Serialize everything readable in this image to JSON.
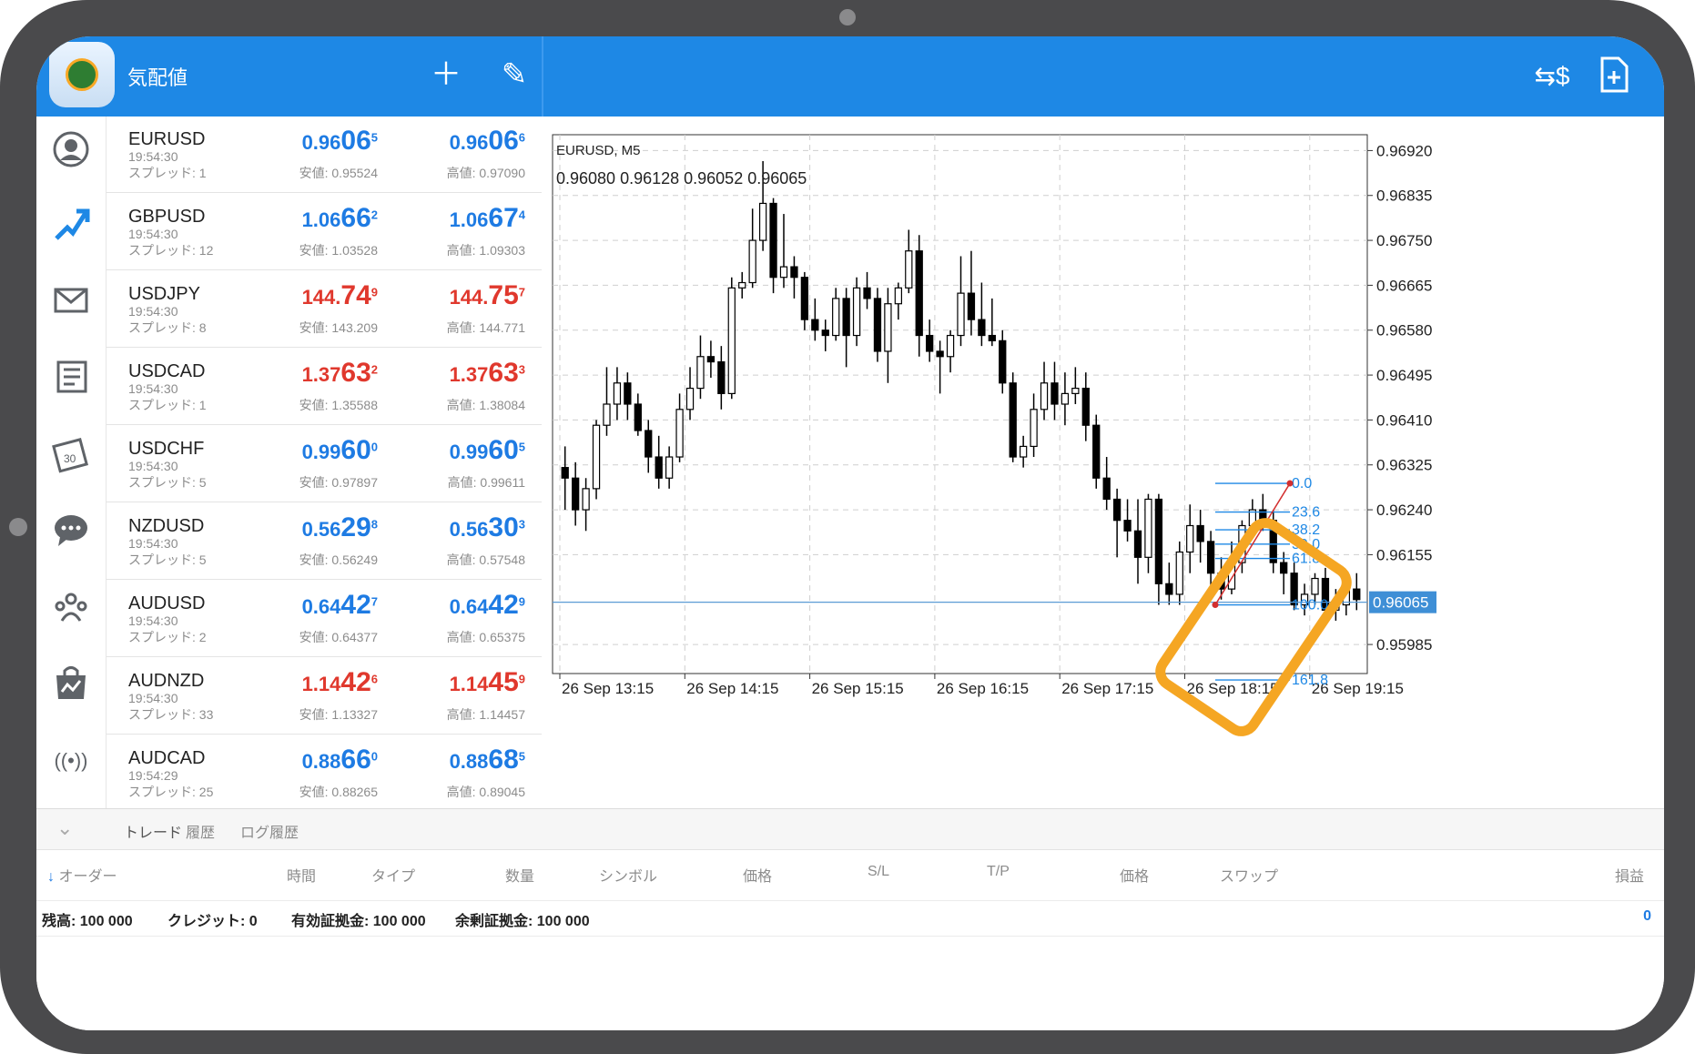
{
  "header": {
    "title": "気配値",
    "add_icon": "plus-icon",
    "edit_icon": "pencil-icon",
    "currency_icon": "currency-switch-icon",
    "new_order_icon": "new-document-icon"
  },
  "nav": [
    "quotes-icon",
    "chart-icon",
    "mail-icon",
    "news-icon",
    "calendar-icon",
    "chat-icon",
    "community-icon",
    "market-icon",
    "signal-icon"
  ],
  "quotes": [
    {
      "symbol": "EURUSD",
      "time": "19:54:30",
      "spread": "スプレッド: 1",
      "bid_head": "0.96",
      "bid_big": "06",
      "bid_sup": "5",
      "ask_head": "0.96",
      "ask_big": "06",
      "ask_sup": "6",
      "low": "安値: 0.95524",
      "high": "高値: 0.97090",
      "color": "blue"
    },
    {
      "symbol": "GBPUSD",
      "time": "19:54:30",
      "spread": "スプレッド: 12",
      "bid_head": "1.06",
      "bid_big": "66",
      "bid_sup": "2",
      "ask_head": "1.06",
      "ask_big": "67",
      "ask_sup": "4",
      "low": "安値: 1.03528",
      "high": "高値: 1.09303",
      "color": "blue"
    },
    {
      "symbol": "USDJPY",
      "time": "19:54:30",
      "spread": "スプレッド: 8",
      "bid_head": "144.",
      "bid_big": "74",
      "bid_sup": "9",
      "ask_head": "144.",
      "ask_big": "75",
      "ask_sup": "7",
      "low": "安値: 143.209",
      "high": "高値: 144.771",
      "color": "red"
    },
    {
      "symbol": "USDCAD",
      "time": "19:54:30",
      "spread": "スプレッド: 1",
      "bid_head": "1.37",
      "bid_big": "63",
      "bid_sup": "2",
      "ask_head": "1.37",
      "ask_big": "63",
      "ask_sup": "3",
      "low": "安値: 1.35588",
      "high": "高値: 1.38084",
      "color": "red"
    },
    {
      "symbol": "USDCHF",
      "time": "19:54:30",
      "spread": "スプレッド: 5",
      "bid_head": "0.99",
      "bid_big": "60",
      "bid_sup": "0",
      "ask_head": "0.99",
      "ask_big": "60",
      "ask_sup": "5",
      "low": "安値: 0.97897",
      "high": "高値: 0.99611",
      "color": "blue"
    },
    {
      "symbol": "NZDUSD",
      "time": "19:54:30",
      "spread": "スプレッド: 5",
      "bid_head": "0.56",
      "bid_big": "29",
      "bid_sup": "8",
      "ask_head": "0.56",
      "ask_big": "30",
      "ask_sup": "3",
      "low": "安値: 0.56249",
      "high": "高値: 0.57548",
      "color": "blue"
    },
    {
      "symbol": "AUDUSD",
      "time": "19:54:30",
      "spread": "スプレッド: 2",
      "bid_head": "0.64",
      "bid_big": "42",
      "bid_sup": "7",
      "ask_head": "0.64",
      "ask_big": "42",
      "ask_sup": "9",
      "low": "安値: 0.64377",
      "high": "高値: 0.65375",
      "color": "blue"
    },
    {
      "symbol": "AUDNZD",
      "time": "19:54:30",
      "spread": "スプレッド: 33",
      "bid_head": "1.14",
      "bid_big": "42",
      "bid_sup": "6",
      "ask_head": "1.14",
      "ask_big": "45",
      "ask_sup": "9",
      "low": "安値: 1.13327",
      "high": "高値: 1.14457",
      "color": "red"
    },
    {
      "symbol": "AUDCAD",
      "time": "19:54:29",
      "spread": "スプレッド: 25",
      "bid_head": "0.88",
      "bid_big": "66",
      "bid_sup": "0",
      "ask_head": "0.88",
      "ask_big": "68",
      "ask_sup": "5",
      "low": "安値: 0.88265",
      "high": "高値: 0.89045",
      "color": "blue"
    }
  ],
  "chart": {
    "symbol_tf": "EURUSD, M5",
    "ohlc": "0.96080 0.96128 0.96052 0.96065",
    "current_price": "0.96065",
    "price_labels": [
      "0.96920",
      "0.96835",
      "0.96750",
      "0.96665",
      "0.96580",
      "0.96495",
      "0.96410",
      "0.96325",
      "0.96240",
      "0.96155",
      "0.95985"
    ],
    "time_labels": [
      "26 Sep 13:15",
      "26 Sep 14:15",
      "26 Sep 15:15",
      "26 Sep 16:15",
      "26 Sep 17:15",
      "26 Sep 18:15",
      "26 Sep 19:15"
    ],
    "fib_levels": [
      "0.0",
      "23.6",
      "38.2",
      "50.0",
      "61.8",
      "100.0",
      "161.8"
    ],
    "highlight_color": "#f5a623"
  },
  "chart_data": {
    "type": "candlestick",
    "title": "EURUSD, M5",
    "ylim": [
      0.9593,
      0.9695
    ],
    "candles": [
      [
        0.9632,
        0.9636,
        0.9624,
        0.963
      ],
      [
        0.963,
        0.9633,
        0.9621,
        0.9624
      ],
      [
        0.9624,
        0.963,
        0.962,
        0.9628
      ],
      [
        0.9628,
        0.9641,
        0.9626,
        0.964
      ],
      [
        0.964,
        0.9651,
        0.9638,
        0.9644
      ],
      [
        0.9644,
        0.9651,
        0.9641,
        0.9648
      ],
      [
        0.9648,
        0.965,
        0.9641,
        0.9644
      ],
      [
        0.9644,
        0.9646,
        0.9638,
        0.9639
      ],
      [
        0.9639,
        0.9641,
        0.9631,
        0.9634
      ],
      [
        0.9634,
        0.9638,
        0.9628,
        0.963
      ],
      [
        0.963,
        0.9636,
        0.9628,
        0.9634
      ],
      [
        0.9634,
        0.9646,
        0.9633,
        0.9643
      ],
      [
        0.9643,
        0.9651,
        0.9641,
        0.9647
      ],
      [
        0.9647,
        0.9657,
        0.9645,
        0.9653
      ],
      [
        0.9653,
        0.9656,
        0.9649,
        0.9652
      ],
      [
        0.9652,
        0.9655,
        0.9643,
        0.9646
      ],
      [
        0.9646,
        0.9668,
        0.9645,
        0.9666
      ],
      [
        0.9666,
        0.9669,
        0.9664,
        0.9667
      ],
      [
        0.9667,
        0.9681,
        0.9666,
        0.9675
      ],
      [
        0.9675,
        0.969,
        0.9673,
        0.9682
      ],
      [
        0.9682,
        0.9683,
        0.9665,
        0.9668
      ],
      [
        0.9668,
        0.968,
        0.9666,
        0.967
      ],
      [
        0.967,
        0.9672,
        0.9664,
        0.9668
      ],
      [
        0.9668,
        0.9669,
        0.9658,
        0.966
      ],
      [
        0.966,
        0.9664,
        0.9656,
        0.9658
      ],
      [
        0.9658,
        0.966,
        0.9654,
        0.9657
      ],
      [
        0.9657,
        0.9666,
        0.9656,
        0.9664
      ],
      [
        0.9664,
        0.9666,
        0.9651,
        0.9657
      ],
      [
        0.9657,
        0.9668,
        0.9655,
        0.9666
      ],
      [
        0.9666,
        0.9669,
        0.9662,
        0.9664
      ],
      [
        0.9664,
        0.9666,
        0.9652,
        0.9654
      ],
      [
        0.9654,
        0.9666,
        0.9648,
        0.9663
      ],
      [
        0.9663,
        0.9667,
        0.966,
        0.9666
      ],
      [
        0.9666,
        0.9677,
        0.9665,
        0.9673
      ],
      [
        0.9673,
        0.9676,
        0.9653,
        0.9657
      ],
      [
        0.9657,
        0.966,
        0.9652,
        0.9654
      ],
      [
        0.9654,
        0.9656,
        0.9646,
        0.9653
      ],
      [
        0.9653,
        0.9658,
        0.965,
        0.9657
      ],
      [
        0.9657,
        0.9672,
        0.9655,
        0.9665
      ],
      [
        0.9665,
        0.9673,
        0.9657,
        0.966
      ],
      [
        0.966,
        0.9667,
        0.9655,
        0.9657
      ],
      [
        0.9657,
        0.9664,
        0.9655,
        0.9656
      ],
      [
        0.9656,
        0.9658,
        0.9646,
        0.9648
      ],
      [
        0.9648,
        0.965,
        0.9633,
        0.9634
      ],
      [
        0.9634,
        0.9638,
        0.9632,
        0.9636
      ],
      [
        0.9636,
        0.9646,
        0.9634,
        0.9643
      ],
      [
        0.9643,
        0.9652,
        0.9641,
        0.9648
      ],
      [
        0.9648,
        0.9652,
        0.9641,
        0.9644
      ],
      [
        0.9644,
        0.965,
        0.964,
        0.9646
      ],
      [
        0.9646,
        0.9651,
        0.9644,
        0.9647
      ],
      [
        0.9647,
        0.965,
        0.9637,
        0.964
      ],
      [
        0.964,
        0.9642,
        0.9628,
        0.963
      ],
      [
        0.963,
        0.9634,
        0.9624,
        0.9626
      ],
      [
        0.9626,
        0.9628,
        0.9615,
        0.9622
      ],
      [
        0.9622,
        0.9626,
        0.9618,
        0.962
      ],
      [
        0.962,
        0.9626,
        0.961,
        0.9615
      ],
      [
        0.9615,
        0.9627,
        0.9612,
        0.9626
      ],
      [
        0.9626,
        0.9627,
        0.9606,
        0.961
      ],
      [
        0.961,
        0.9614,
        0.9606,
        0.9608
      ],
      [
        0.9608,
        0.9618,
        0.9606,
        0.9616
      ],
      [
        0.9616,
        0.9625,
        0.9612,
        0.9621
      ],
      [
        0.9621,
        0.9624,
        0.9614,
        0.9618
      ],
      [
        0.9618,
        0.962,
        0.9608,
        0.9612
      ],
      [
        0.9612,
        0.9615,
        0.9607,
        0.9609
      ],
      [
        0.9609,
        0.9618,
        0.9608,
        0.9614
      ],
      [
        0.9614,
        0.9622,
        0.9612,
        0.9621
      ],
      [
        0.9621,
        0.9626,
        0.9619,
        0.9624
      ],
      [
        0.9624,
        0.9627,
        0.962,
        0.9622
      ],
      [
        0.9622,
        0.9624,
        0.9612,
        0.9614
      ],
      [
        0.9614,
        0.9616,
        0.9608,
        0.9612
      ],
      [
        0.9612,
        0.9614,
        0.9605,
        0.9606
      ],
      [
        0.9606,
        0.961,
        0.9604,
        0.9608
      ],
      [
        0.9608,
        0.9612,
        0.9606,
        0.9611
      ],
      [
        0.9611,
        0.9613,
        0.9603,
        0.9605
      ],
      [
        0.9605,
        0.9609,
        0.9603,
        0.9606
      ],
      [
        0.9606,
        0.9612,
        0.9604,
        0.9609
      ],
      [
        0.9609,
        0.9612,
        0.9605,
        0.9607
      ]
    ]
  },
  "terminal": {
    "tabs": [
      "トレード",
      "履歴",
      "ログ履歴"
    ],
    "columns": [
      "オーダー",
      "時間",
      "タイプ",
      "数量",
      "シンボル",
      "価格",
      "S/L",
      "T/P",
      "価格",
      "スワップ",
      "損益"
    ],
    "balance": "残高:  100 000",
    "credit": "クレジット:  0",
    "equity": "有効証拠金:  100 000",
    "free_margin": "余剰証拠金:  100 000",
    "profit": "0"
  }
}
